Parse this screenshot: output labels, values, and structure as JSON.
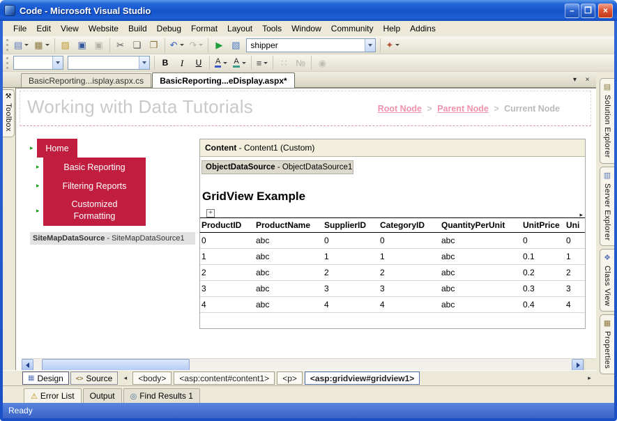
{
  "icons": {
    "chevron_down": "▾",
    "scroll_left": "◂",
    "scroll_right": "▸"
  },
  "window": {
    "title": "Code - Microsoft Visual Studio",
    "status_text": "Ready"
  },
  "titlebar_controls": [
    {
      "name": "minimize-button",
      "icon_name": "minimize-icon",
      "glyph": "–"
    },
    {
      "name": "maximize-button",
      "icon_name": "maximize-icon",
      "glyph": "❐"
    },
    {
      "name": "close-button",
      "icon_name": "close-icon",
      "glyph": "×",
      "cls": "close"
    }
  ],
  "menubar": {
    "items": [
      "File",
      "Edit",
      "View",
      "Website",
      "Build",
      "Debug",
      "Format",
      "Layout",
      "Tools",
      "Window",
      "Community",
      "Help",
      "Addins"
    ]
  },
  "toolbar_main": {
    "buttons": [
      {
        "name": "toolbar-grip",
        "separator": true,
        "cls": "grip"
      },
      {
        "name": "new-website-button",
        "icon_name": "new-website-icon",
        "glyph": "▤",
        "color": "#5b79b8",
        "dropdown": true
      },
      {
        "name": "add-new-item-button",
        "icon_name": "add-new-item-icon",
        "glyph": "▦",
        "color": "#8d7a3e",
        "dropdown": true
      },
      {
        "name": "toolbar-separator",
        "separator": true
      },
      {
        "name": "open-file-button",
        "icon_name": "open-folder-icon",
        "glyph": "▨",
        "color": "#c29a30"
      },
      {
        "name": "save-button",
        "icon_name": "save-icon",
        "glyph": "▣",
        "color": "#35589e"
      },
      {
        "name": "save-all-button",
        "icon_name": "save-all-icon",
        "glyph": "▣",
        "color": "#35589e",
        "disabled": true
      },
      {
        "name": "toolbar-separator",
        "separator": true
      },
      {
        "name": "cut-button",
        "icon_name": "scissors-icon",
        "glyph": "✂",
        "color": "#555555"
      },
      {
        "name": "copy-button",
        "icon_name": "copy-icon",
        "glyph": "❏",
        "color": "#555555"
      },
      {
        "name": "paste-button",
        "icon_name": "paste-icon",
        "glyph": "❐",
        "color": "#8a6d3b"
      },
      {
        "name": "toolbar-separator",
        "separator": true
      },
      {
        "name": "undo-button",
        "icon_name": "undo-icon",
        "glyph": "↶",
        "color": "#2f5fc0",
        "dropdown": true
      },
      {
        "name": "redo-button",
        "icon_name": "redo-icon",
        "glyph": "↷",
        "color": "#2f5fc0",
        "dropdown": true,
        "disabled": true
      },
      {
        "name": "toolbar-separator",
        "separator": true
      },
      {
        "name": "start-debugging-button",
        "icon_name": "play-icon",
        "glyph": "▶",
        "color": "#1f9e3a"
      },
      {
        "name": "view-in-browser-button",
        "icon_name": "browser-icon",
        "glyph": "▧",
        "color": "#4a79c2"
      }
    ],
    "combo_value": "shipper",
    "buttons_after": [
      {
        "name": "toolbar-separator",
        "separator": true
      },
      {
        "name": "other-windows-button",
        "icon_name": "sparkle-icon",
        "glyph": "✦",
        "color": "#b5543a",
        "dropdown": true
      }
    ]
  },
  "toolbar_format": {
    "style_combo_value": "",
    "font_combo_value": "",
    "buttons": [
      {
        "name": "toolbar-grip",
        "separator": true,
        "cls": "grip"
      }
    ],
    "buttons_after": [
      {
        "name": "toolbar-separator",
        "separator": true
      },
      {
        "name": "bold-button",
        "icon_name": "bold-icon",
        "glyph": "B",
        "cls": "fmt-b"
      },
      {
        "name": "italic-button",
        "icon_name": "italic-icon",
        "glyph": "I",
        "cls": "fmt-i"
      },
      {
        "name": "underline-button",
        "icon_name": "underline-icon",
        "glyph": "U",
        "cls": "fmt-u"
      },
      {
        "name": "toolbar-separator",
        "separator": true
      },
      {
        "name": "font-color-button",
        "icon_name": "font-color-icon",
        "glyph": "A",
        "cls": "fmt-color",
        "color": "#222222",
        "dropdown": true
      },
      {
        "name": "highlight-button",
        "icon_name": "highlight-icon",
        "glyph": "A",
        "cls": "fmt-highlight",
        "color": "#222222",
        "dropdown": true
      },
      {
        "name": "toolbar-separator",
        "separator": true
      },
      {
        "name": "alignment-button",
        "icon_name": "align-left-icon",
        "glyph": "≡",
        "color": "#444444",
        "dropdown": true
      },
      {
        "name": "toolbar-separator",
        "separator": true
      },
      {
        "name": "bullet-list-button",
        "icon_name": "bullet-list-icon",
        "glyph": "∷",
        "color": "#555555",
        "disabled": true
      },
      {
        "name": "numbered-list-button",
        "icon_name": "numbered-list-icon",
        "glyph": "№",
        "color": "#555555",
        "disabled": true
      },
      {
        "name": "toolbar-separator",
        "separator": true
      },
      {
        "name": "hyperlink-button",
        "icon_name": "hyperlink-icon",
        "glyph": "◉",
        "color": "#5a7ab5",
        "disabled": true
      }
    ]
  },
  "document_tabs": [
    {
      "name": "tab-code-behind",
      "label": "BasicReporting...isplay.aspx.cs"
    },
    {
      "name": "tab-markup",
      "label": "BasicReporting...eDisplay.aspx*",
      "active": true
    }
  ],
  "tab_controls": [
    {
      "name": "document-list-button",
      "icon_name": "chevron-down-icon",
      "glyph": "▾"
    },
    {
      "name": "close-document-button",
      "icon_name": "close-icon",
      "glyph": "×"
    }
  ],
  "left_panel": {
    "label": "Toolbox",
    "glyph": "⚒"
  },
  "right_tabs": [
    {
      "name": "tab-solution-explorer",
      "icon_name": "solution-explorer-icon",
      "label": "Solution Explorer",
      "glyph": "▤",
      "color": "#8d7a3e"
    },
    {
      "name": "tab-server-explorer",
      "icon_name": "server-explorer-icon",
      "label": "Server Explorer",
      "glyph": "▥",
      "color": "#5b79b8"
    },
    {
      "name": "tab-class-view",
      "icon_name": "class-view-icon",
      "label": "Class View",
      "glyph": "❖",
      "color": "#5b79b8"
    },
    {
      "name": "tab-properties",
      "icon_name": "properties-icon",
      "label": "Properties",
      "glyph": "▦",
      "color": "#8d7a3e"
    }
  ],
  "design": {
    "page_title": "Working with Data Tutorials",
    "breadcrumb": {
      "root": "Root Node",
      "parent": "Parent Node",
      "current": "Current Node",
      "sep": ">"
    },
    "nav": {
      "arrow_glyph": "▸",
      "items": [
        {
          "name": "nav-item-home",
          "label": "Home",
          "cls": "nav-home"
        },
        {
          "name": "nav-item-basic-reporting",
          "label": "Basic Reporting"
        },
        {
          "name": "nav-item-filtering-reports",
          "label": "Filtering Reports"
        },
        {
          "name": "nav-item-customized-formatting",
          "label": "Customized Formatting",
          "cls": "nav-tall"
        }
      ]
    },
    "sitemap": {
      "bold": "SiteMapDataSource",
      "rest": " - SiteMapDataSource1"
    },
    "content_header": {
      "bold": "Content",
      "rest": " - Content1 (Custom)"
    },
    "ods": {
      "bold": "ObjectDataSource",
      "rest": " - ObjectDataSource1"
    },
    "grid_title": "GridView Example",
    "move_glyph": "+",
    "grid": {
      "columns": [
        "ProductID",
        "ProductName",
        "SupplierID",
        "CategoryID",
        "QuantityPerUnit",
        "UnitPrice",
        "Uni"
      ],
      "rows": [
        [
          "0",
          "abc",
          "0",
          "0",
          "abc",
          "0",
          "0"
        ],
        [
          "1",
          "abc",
          "1",
          "1",
          "abc",
          "0.1",
          "1"
        ],
        [
          "2",
          "abc",
          "2",
          "2",
          "abc",
          "0.2",
          "2"
        ],
        [
          "3",
          "abc",
          "3",
          "3",
          "abc",
          "0.3",
          "3"
        ],
        [
          "4",
          "abc",
          "4",
          "4",
          "abc",
          "0.4",
          "4"
        ]
      ]
    }
  },
  "tag_navigator": {
    "design_label": "Design",
    "source_label": "Source",
    "design_icon": "▦",
    "source_icon": "<>",
    "tags": [
      {
        "name": "tag-body",
        "label": "<body>"
      },
      {
        "name": "tag-asp-content",
        "label": "<asp:content#content1>"
      },
      {
        "name": "tag-p",
        "label": "<p>"
      },
      {
        "name": "tag-asp-gridview",
        "label": "<asp:gridview#gridview1>",
        "active": true
      }
    ]
  },
  "bottom_tabs": [
    {
      "name": "tab-error-list",
      "icon_name": "warning-icon",
      "label": "Error List",
      "glyph": "⚠",
      "color": "#c08c00"
    },
    {
      "name": "tab-output",
      "icon_name": "output-icon",
      "label": "Output",
      "glyph": ""
    },
    {
      "name": "tab-find-results",
      "icon_name": "search-icon",
      "label": "Find Results 1",
      "glyph": "◎",
      "color": "#4a6a9a"
    }
  ]
}
